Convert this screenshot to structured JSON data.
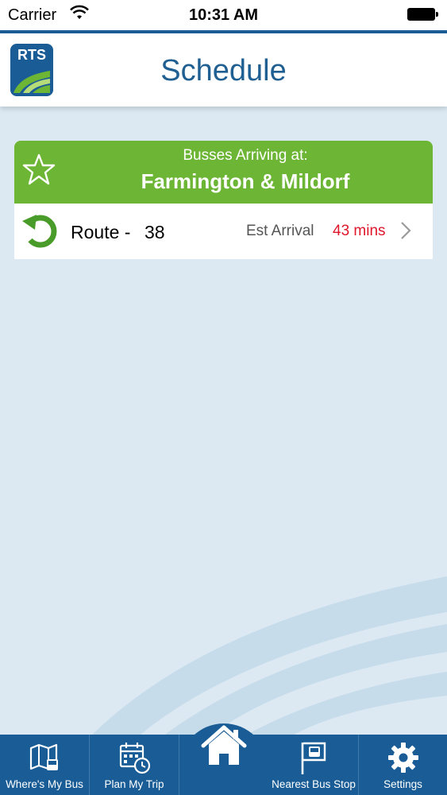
{
  "status_bar": {
    "carrier": "Carrier",
    "time": "10:31 AM"
  },
  "header": {
    "logo_text": "RTS",
    "title": "Schedule"
  },
  "stop_card": {
    "subtitle": "Busses Arriving at:",
    "stop_name": "Farmington & Mildorf",
    "route_label": "Route -",
    "route_number": "38",
    "est_label": "Est Arrival",
    "est_value": "43 mins"
  },
  "tab_bar": {
    "tabs": [
      {
        "label": "Where's My Bus",
        "icon": "map-bus-icon"
      },
      {
        "label": "Plan My Trip",
        "icon": "calendar-clock-icon"
      },
      {
        "label": "",
        "icon": "home-icon"
      },
      {
        "label": "Nearest Bus Stop",
        "icon": "bus-stop-flag-icon"
      },
      {
        "label": "Settings",
        "icon": "gear-icon"
      }
    ]
  },
  "colors": {
    "brand_blue": "#1a5d96",
    "header_title": "#1f5f92",
    "accent_green": "#6db535",
    "arrival_red": "#e0162b",
    "background": "#dce9f3"
  }
}
